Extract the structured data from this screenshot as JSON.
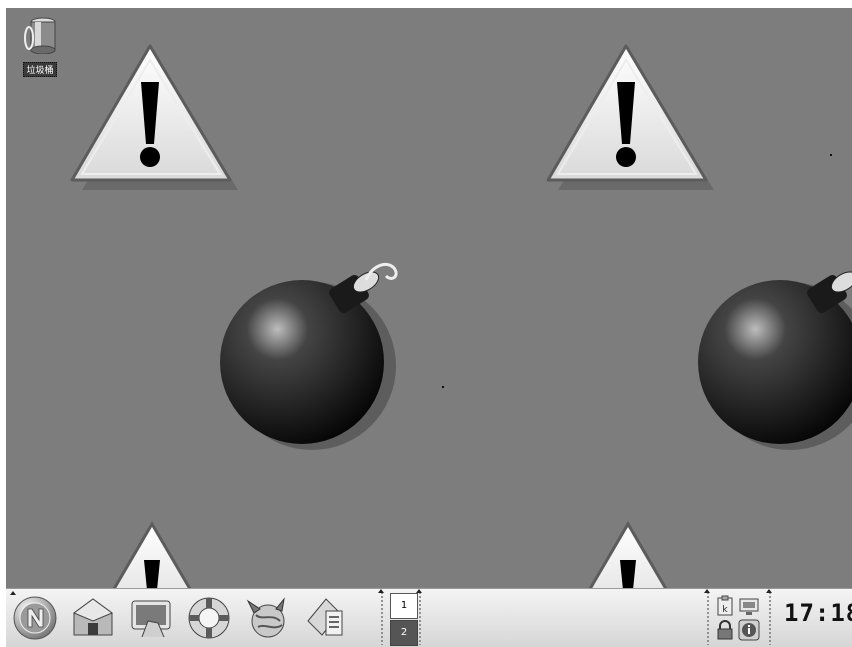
{
  "desktop": {
    "background": "#7d7d7d",
    "trash_label": "垃圾桶",
    "wallpaper_icons": [
      "warning-icon",
      "bomb-icon"
    ]
  },
  "taskbar": {
    "launchers": [
      "kmenu-n-icon",
      "home-icon",
      "desktop-icon",
      "help-lifebuoy-icon",
      "web-browser-icon",
      "office-icon"
    ],
    "pager": {
      "desktop_1": "1",
      "desktop_2": "2",
      "active": "1"
    },
    "tray": [
      "klipper-icon",
      "network-icon",
      "lock-icon",
      "info-icon"
    ],
    "clock": "17:18"
  },
  "colors": {
    "taskbar": "#e4e4e4",
    "pager_active": "#ffffff",
    "pager_inactive": "#555555"
  }
}
